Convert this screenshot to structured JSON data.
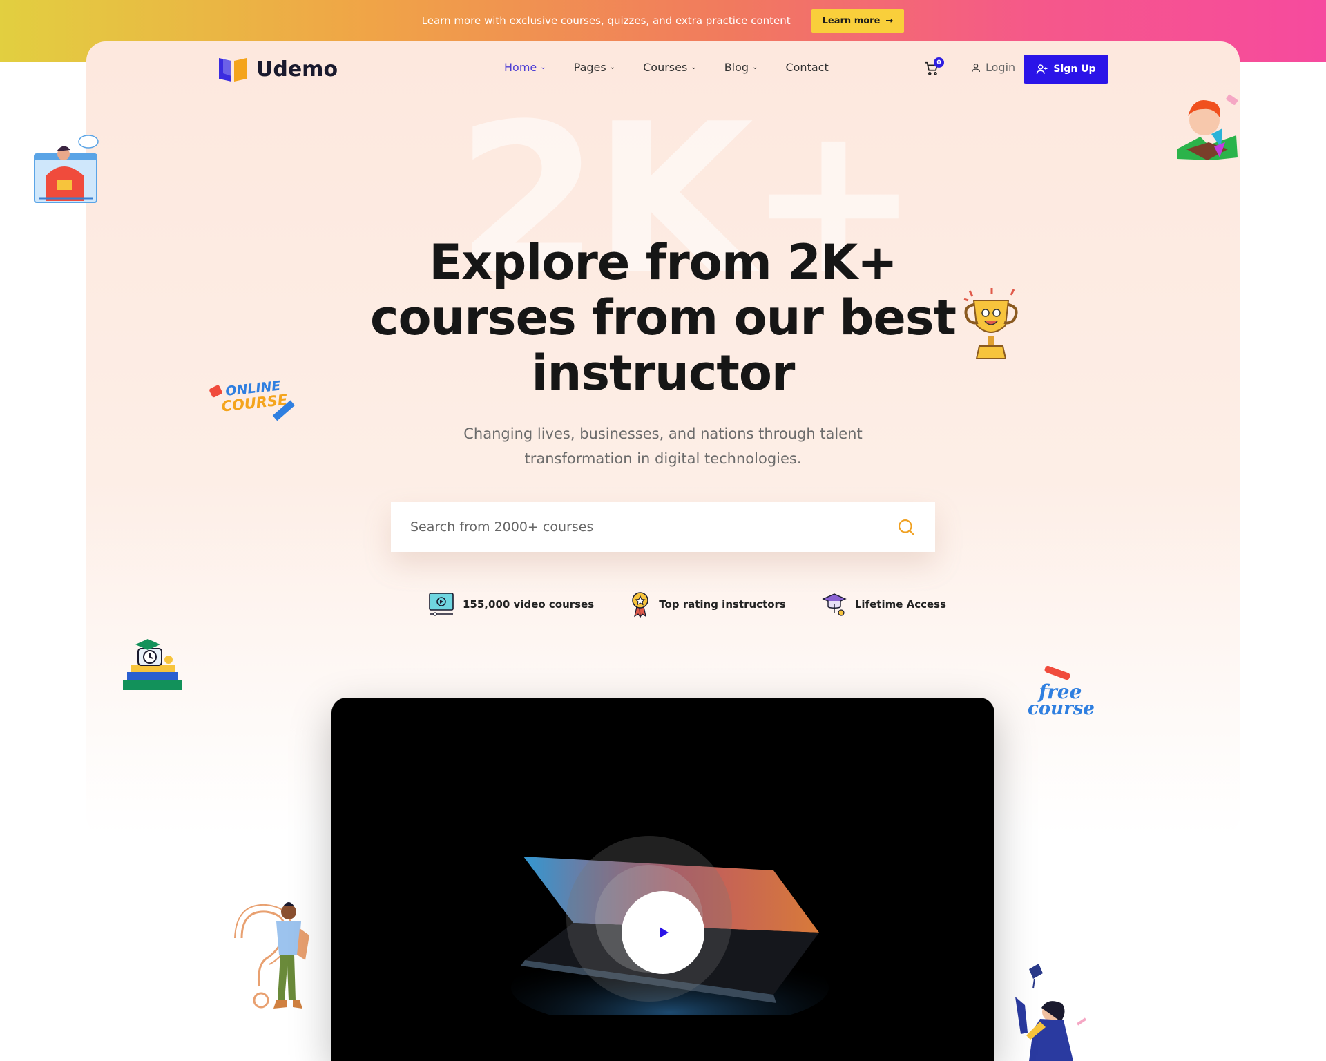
{
  "promo": {
    "text": "Learn more with exclusive courses, quizzes, and extra practice content",
    "button_label": "Learn more"
  },
  "header": {
    "logo_text": "Udemo",
    "nav": [
      {
        "label": "Home",
        "active": true
      },
      {
        "label": "Pages"
      },
      {
        "label": "Courses"
      },
      {
        "label": "Blog"
      },
      {
        "label": "Contact"
      }
    ],
    "cart_count": "0",
    "login_label": "Login",
    "signup_label": "Sign Up"
  },
  "hero": {
    "bg_number": "2K+",
    "title": "Explore from 2K+ courses from our best instructor",
    "subtitle": "Changing lives, businesses, and nations through talent transformation in digital technologies.",
    "search_placeholder": "Search from 2000+ courses"
  },
  "features": [
    {
      "label": "155,000 video courses",
      "icon": "video-icon"
    },
    {
      "label": "Top rating instructors",
      "icon": "medal-icon"
    },
    {
      "label": "Lifetime Access",
      "icon": "graduation-cap-icon"
    }
  ],
  "decor_text": {
    "online_course": [
      "ONLINE",
      "COURSE"
    ],
    "free_course": [
      "free",
      "course"
    ]
  },
  "colors": {
    "accent": "#2b14e8",
    "nav_active": "#4d3ed4",
    "promo_button": "#f9cf3b",
    "search_icon": "#f0a020"
  }
}
